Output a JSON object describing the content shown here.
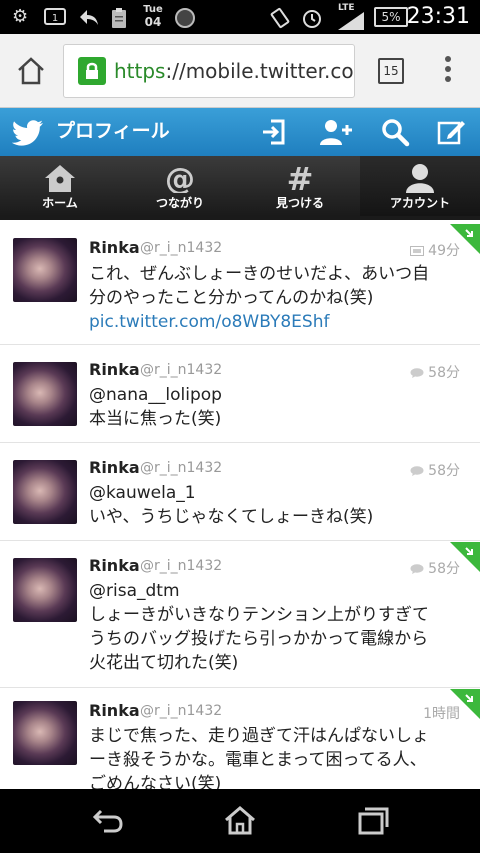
{
  "status": {
    "day_name": "Tue",
    "day_number": "04",
    "network": "LTE",
    "battery": "5%",
    "time": "23:31"
  },
  "browser": {
    "url_scheme": "https",
    "url_rest": "://mobile.twitter.com/r",
    "tab_count": "15"
  },
  "header": {
    "title": "プロフィール"
  },
  "nav": {
    "tabs": [
      {
        "label": "ホーム",
        "icon": "home-icon"
      },
      {
        "label": "つながり",
        "icon": "at-icon"
      },
      {
        "label": "見つける",
        "icon": "hash-icon"
      },
      {
        "label": "アカウント",
        "icon": "person-icon"
      }
    ]
  },
  "tweets": [
    {
      "name": "Rinka",
      "handle": "@r_i_n1432",
      "time": "49分",
      "lines": [
        "これ、ぜんぶしょーきのせいだよ、あいつ自",
        "分のやったこと分かってんのかね(笑)"
      ],
      "link": "pic.twitter.com/o8WBY8EShf",
      "meta_icon": "photo-icon",
      "corner": true
    },
    {
      "name": "Rinka",
      "handle": "@r_i_n1432",
      "time": "58分",
      "lines": [
        "@nana__lolipop",
        "本当に焦った(笑)"
      ],
      "meta_icon": "reply-bubble-icon",
      "corner": false
    },
    {
      "name": "Rinka",
      "handle": "@r_i_n1432",
      "time": "58分",
      "lines": [
        "@kauwela_1",
        "いや、うちじゃなくてしょーきね(笑)"
      ],
      "meta_icon": "reply-bubble-icon",
      "corner": false
    },
    {
      "name": "Rinka",
      "handle": "@r_i_n1432",
      "time": "58分",
      "lines": [
        "@risa_dtm",
        "しょーきがいきなりテンション上がりすぎて",
        "うちのバッグ投げたら引っかかって電線から",
        "火花出て切れた(笑)"
      ],
      "meta_icon": "reply-bubble-icon",
      "corner": true
    },
    {
      "name": "Rinka",
      "handle": "@r_i_n1432",
      "time": "1時間",
      "lines": [
        "まじで焦った、走り過ぎて汗はんぱないしょ",
        "ーき殺そうかな。電車とまって困ってる人、",
        "ごめんなさい(笑)"
      ],
      "meta_icon": "",
      "corner": true
    }
  ],
  "colors": {
    "twitter_blue": "#2b8fd0",
    "corner_green": "#3cb83c",
    "link": "#2b7bb9"
  }
}
